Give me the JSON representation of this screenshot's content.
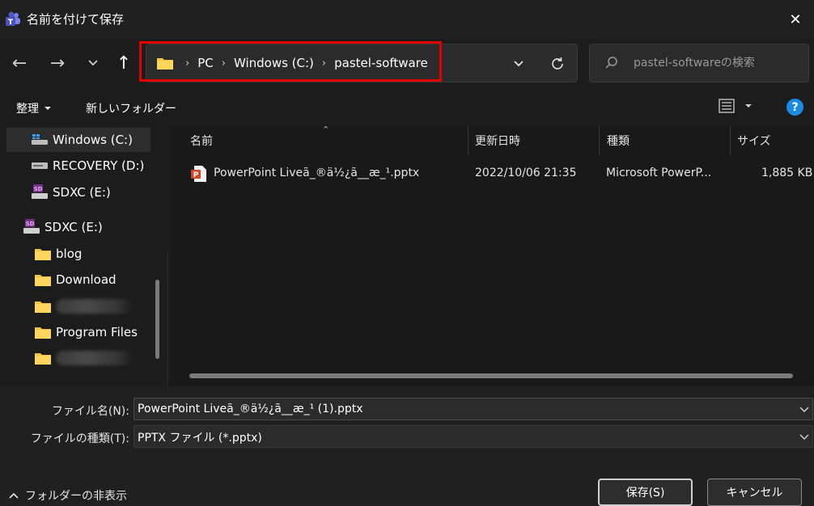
{
  "window": {
    "title": "名前を付けて保存",
    "close_glyph": "✕"
  },
  "nav": {
    "back_glyph": "←",
    "forward_glyph": "→",
    "recent_glyph": "⌄",
    "up_glyph": "↑"
  },
  "address": {
    "crumbs": [
      "PC",
      "Windows (C:)",
      "pastel-software"
    ],
    "sep_glyph": "›",
    "highlight_color": "#e40000"
  },
  "search": {
    "placeholder": "pastel-softwareの検索"
  },
  "toolbar": {
    "organize_label": "整理",
    "newfolder_label": "新しいフォルダー",
    "help_label": "?"
  },
  "navpane": {
    "items": [
      {
        "label": "Windows (C:)",
        "icon": "drive-windows-icon"
      },
      {
        "label": "RECOVERY (D:)",
        "icon": "drive-icon"
      },
      {
        "label": "SDXC (E:)",
        "icon": "sd-card-icon"
      },
      {
        "label": "SDXC (E:)",
        "icon": "sd-card-icon"
      },
      {
        "label": "blog",
        "icon": "folder-icon"
      },
      {
        "label": "Download",
        "icon": "folder-icon"
      },
      {
        "label": "",
        "icon": "folder-icon"
      },
      {
        "label": "Program Files",
        "icon": "folder-icon"
      },
      {
        "label": "",
        "icon": "folder-icon"
      }
    ]
  },
  "filelist": {
    "columns": {
      "name": "名前",
      "modified": "更新日時",
      "type": "種類",
      "size": "サイズ"
    },
    "rows": [
      {
        "name": "PowerPoint Liveã_®ä½¿ã__æ_¹.pptx",
        "modified": "2022/10/06 21:35",
        "type": "Microsoft PowerP...",
        "size": "1,885 KB"
      }
    ]
  },
  "form": {
    "filename_label": "ファイル名(N):",
    "filename_value": "PowerPoint Liveã_®ä½¿ã__æ_¹ (1).pptx",
    "filetype_label": "ファイルの種類(T):",
    "filetype_value": "PPTX ファイル (*.pptx)",
    "toggle_label": "フォルダーの非表示",
    "save_label": "保存(S)",
    "cancel_label": "キャンセル"
  },
  "colors": {
    "folder": "#f4c542",
    "accent": "#1a8ae5",
    "pptx": "#d24726"
  }
}
